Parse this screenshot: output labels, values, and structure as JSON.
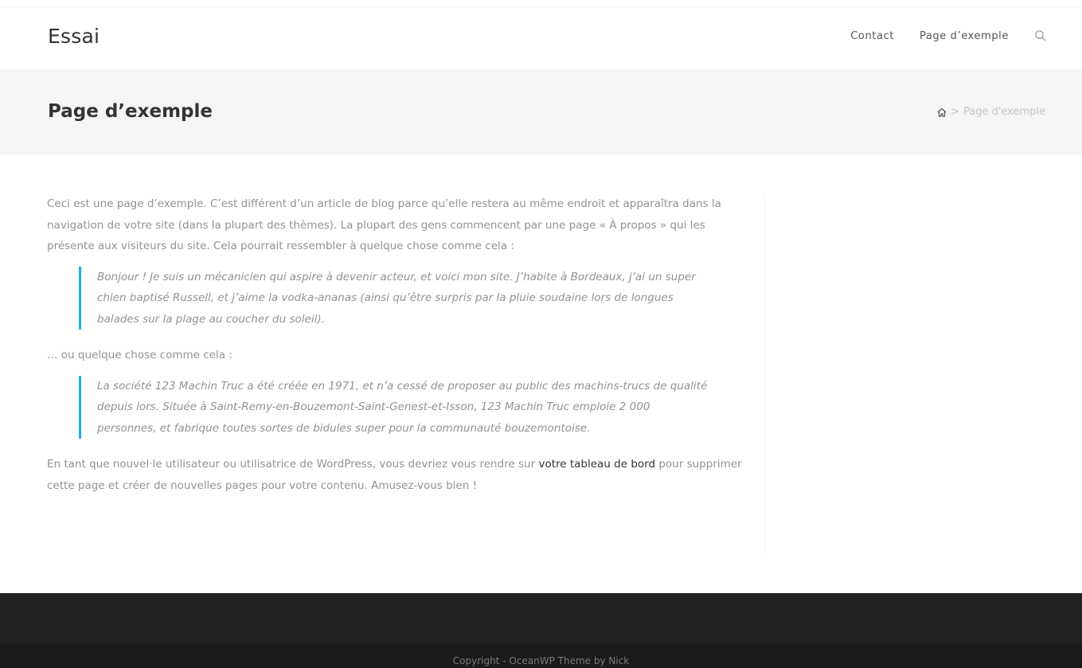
{
  "site": {
    "title": "Essai"
  },
  "nav": {
    "items": [
      {
        "label": "Contact"
      },
      {
        "label": "Page d’exemple"
      }
    ],
    "search_icon": "search-icon"
  },
  "page_header": {
    "title": "Page d’exemple",
    "breadcrumb": {
      "home_icon": "home-icon",
      "separator": ">",
      "current": "Page d'exemple"
    }
  },
  "content": {
    "intro": "Ceci est une page d’exemple. C’est différent d’un article de blog parce qu’elle restera au même endroit et apparaîtra dans la navigation de votre site (dans la plupart des thèmes). La plupart des gens commencent par une page «  À propos  » qui les présente aux visiteurs du site. Cela pourrait ressembler à quelque chose comme cela  :",
    "quote1": "Bonjour  ! Je suis un mécanicien qui aspire à devenir acteur, et voici mon site. J’habite à Bordeaux, j’ai un super chien baptisé Russell, et j’aime la vodka-ananas (ainsi qu’être surpris par la pluie soudaine lors de longues balades sur la plage au coucher du soleil).",
    "middle": "… ou quelque chose comme cela  :",
    "quote2": "La société 123 Machin Truc a été créée en 1971, et n’a cessé de proposer au public des machins-trucs de qualité depuis lors. Située à Saint-Remy-en-Bouzemont-Saint-Genest-et-Isson, 123 Machin Truc emploie 2 000 personnes, et fabrique toutes sortes de bidules super pour la communauté bouzemontoise.",
    "outro_before": "En tant que nouvel·le utilisateur ou utilisatrice de WordPress, vous devriez vous rendre sur ",
    "outro_link": "votre tableau de bord",
    "outro_after": " pour supprimer cette page et créer de nouvelles pages pour votre contenu. Amusez-vous bien  !"
  },
  "footer": {
    "copyright": "Copyright - OceanWP Theme by Nick"
  },
  "colors": {
    "accent": "#13aff0",
    "page_header_bg": "#f5f5f5",
    "footer_bg": "#222222",
    "footer_bottom_bg": "#1b1b1b"
  }
}
